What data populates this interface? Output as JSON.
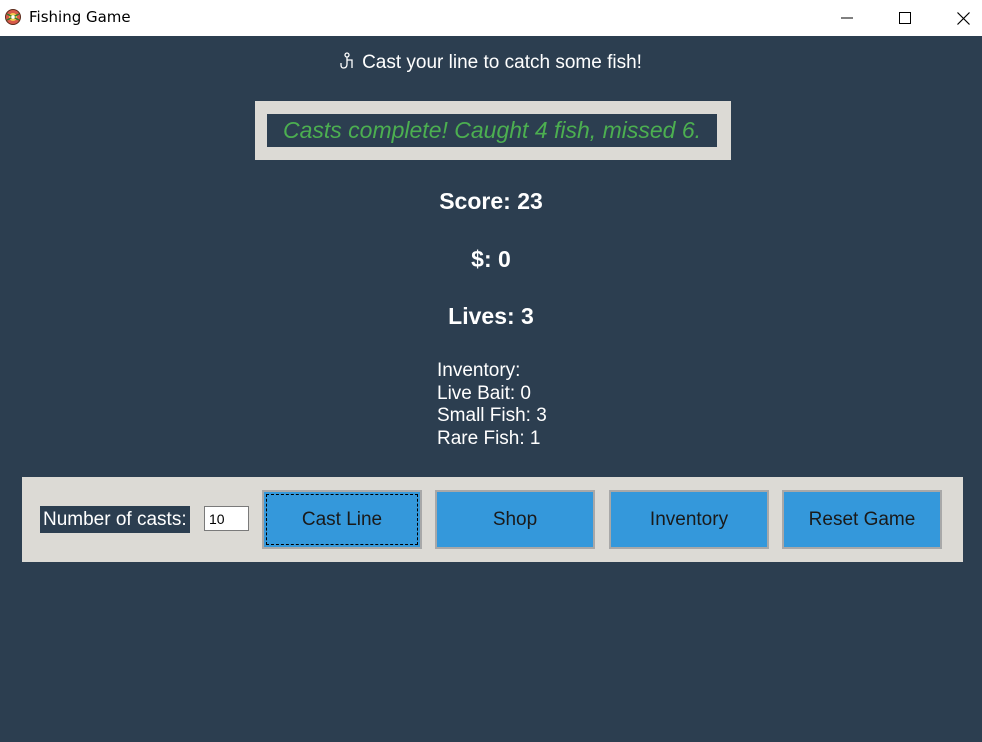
{
  "window": {
    "title": "Fishing Game",
    "icon": "fishing-game-icon"
  },
  "colors": {
    "background": "#2c3e50",
    "message_text": "#4caf50",
    "button": "#3498db",
    "panel": "#dcdad5"
  },
  "header": {
    "icon": "fish-hook-icon",
    "text": "Cast your line to catch some fish!"
  },
  "message": "Casts complete! Caught 4 fish, missed 6.",
  "stats": {
    "score": "Score: 23",
    "money": "$: 0",
    "lives": "Lives: 3"
  },
  "inventory": {
    "title": "Inventory:",
    "lines": [
      "Live Bait: 0",
      "Small Fish: 3",
      "Rare Fish: 1"
    ]
  },
  "controls": {
    "casts_label": "Number of casts:",
    "casts_value": "10",
    "buttons": {
      "cast": "Cast Line",
      "shop": "Shop",
      "inventory": "Inventory",
      "reset": "Reset Game"
    }
  }
}
